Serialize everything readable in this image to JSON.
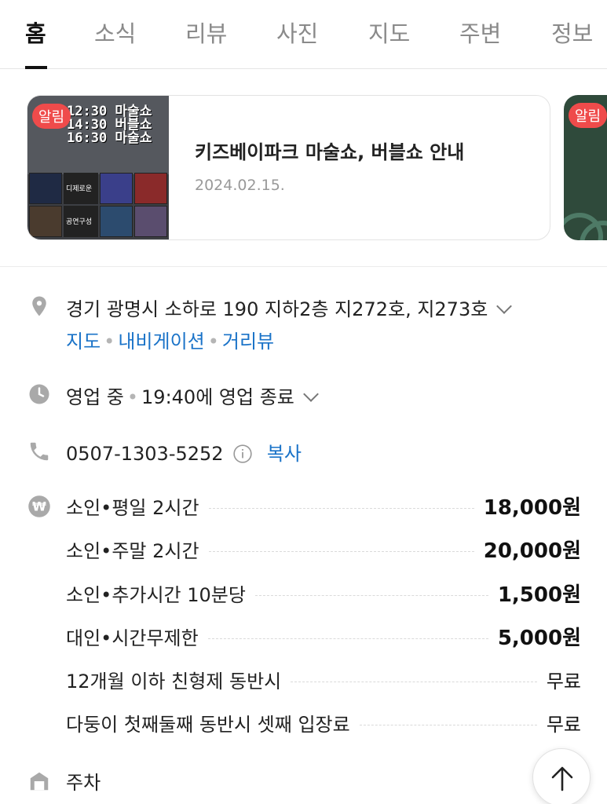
{
  "tabs": [
    {
      "label": "홈",
      "active": true
    },
    {
      "label": "소식"
    },
    {
      "label": "리뷰"
    },
    {
      "label": "사진"
    },
    {
      "label": "지도"
    },
    {
      "label": "주변"
    },
    {
      "label": "정보"
    }
  ],
  "notices": [
    {
      "badge": "알림",
      "title": "키즈베이파크 마술쇼, 버블쇼 안내",
      "date": "2024.02.15.",
      "thumb_lines": [
        "12:30 마술쇼",
        "14:30 버블쇼",
        "16:30 마술쇼"
      ],
      "thumb_caption_1": "디제로운",
      "thumb_caption_2": "공연구성"
    },
    {
      "badge": "알림"
    }
  ],
  "address": {
    "text": "경기 광명시 소하로 190 지하2층 지272호, 지273호",
    "links": [
      "지도",
      "내비게이션",
      "거리뷰"
    ]
  },
  "hours": {
    "status": "영업 중",
    "detail": "19:40에 영업 종료"
  },
  "phone": {
    "number": "0507-1303-5252",
    "copy_label": "복사"
  },
  "prices": [
    {
      "label": "소인•평일 2시간",
      "value": "18,000원"
    },
    {
      "label": "소인•주말 2시간",
      "value": "20,000원"
    },
    {
      "label": "소인•추가시간 10분당",
      "value": "1,500원"
    },
    {
      "label": "대인•시간무제한",
      "value": "5,000원"
    },
    {
      "label": "12개월 이하 친형제 동반시",
      "value": "무료"
    },
    {
      "label": "다둥이 첫째둘째 동반시 셋째 입장료",
      "value": "무료"
    }
  ],
  "parking": {
    "label": "주차"
  },
  "colors": {
    "link": "#1a73c8",
    "badge": "#ef4b4b",
    "icon": "#a9a9a9"
  },
  "icons": [
    "location-pin-icon",
    "clock-icon",
    "phone-icon",
    "info-icon",
    "won-icon",
    "parking-icon",
    "arrow-up-icon"
  ]
}
